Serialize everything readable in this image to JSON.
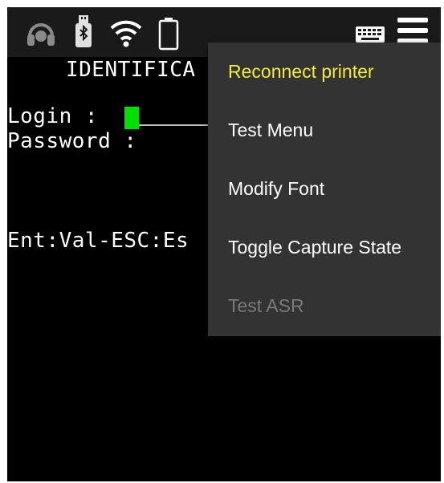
{
  "status_bar": {
    "icons": [
      "headset-icon",
      "usb-icon",
      "wifi-icon",
      "battery-icon",
      "keyboard-icon",
      "hamburger-menu-icon"
    ]
  },
  "terminal": {
    "title": "IDENTIFICA",
    "login_label": "Login :",
    "password_label": "Password :",
    "keys_hint": "Ent:Val-ESC:Es"
  },
  "menu": {
    "items": [
      {
        "label": "Reconnect printer",
        "state": "highlighted"
      },
      {
        "label": "Test Menu",
        "state": "enabled"
      },
      {
        "label": "Modify Font",
        "state": "enabled"
      },
      {
        "label": "Toggle Capture State",
        "state": "enabled"
      },
      {
        "label": "Test ASR",
        "state": "disabled"
      }
    ]
  },
  "colors": {
    "status_bar_bg": "#1a1a1a",
    "terminal_bg": "#000000",
    "terminal_text": "#ffffff",
    "cursor": "#00e000",
    "menu_bg": "#333333",
    "menu_highlight_text": "#f2ec34",
    "menu_disabled_text": "#7a7a7a"
  }
}
